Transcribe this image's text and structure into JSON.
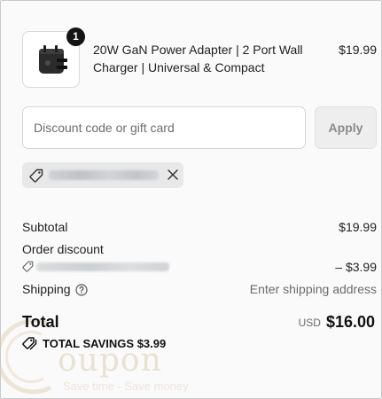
{
  "product": {
    "quantity": "1",
    "title": "20W GaN Power Adapter | 2 Port Wall Charger | Universal & Compact",
    "price": "$19.99",
    "image_icon": "power-adapter-icon"
  },
  "discount": {
    "placeholder": "Discount code or gift card",
    "value": "",
    "apply_label": "Apply",
    "applied_code_icon": "tag-icon",
    "remove_icon": "close-icon"
  },
  "summary": {
    "subtotal_label": "Subtotal",
    "subtotal_value": "$19.99",
    "order_discount_label": "Order discount",
    "order_discount_value": "– $3.99",
    "shipping_label": "Shipping",
    "shipping_value": "Enter shipping address",
    "total_label": "Total",
    "currency": "USD",
    "total_value": "$16.00",
    "savings_label": "TOTAL SAVINGS",
    "savings_value": "$3.99"
  },
  "watermark": {
    "text": "oupon",
    "tagline": "Save time - Save money"
  }
}
